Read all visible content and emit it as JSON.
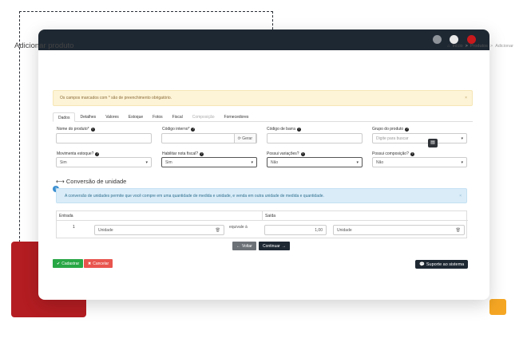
{
  "page": {
    "title": "Adicionar produto"
  },
  "breadcrumb": {
    "home": "Início",
    "sep1": ">",
    "produtos": "Produtos",
    "sep2": ">",
    "current": "Adicionar"
  },
  "alert": {
    "text": "Os campos marcados com * são de preenchimento obrigatório.",
    "close": "×"
  },
  "tabs": [
    "Dados",
    "Detalhes",
    "Valores",
    "Estoque",
    "Fotos",
    "Fiscal",
    "Composição",
    "Fornecedores"
  ],
  "fields": {
    "nome": {
      "label": "Nome do produto*",
      "value": ""
    },
    "codigo_interno": {
      "label": "Código interno*",
      "value": "",
      "action": "Gerar"
    },
    "codigo_barra": {
      "label": "Código de barra",
      "value": ""
    },
    "grupo": {
      "label": "Grupo do produto",
      "placeholder": "Digite para buscar"
    },
    "movimenta": {
      "label": "Movimenta estoque?",
      "value": "Sim"
    },
    "nota_fiscal": {
      "label": "Habilitar nota fiscal?",
      "value": "Sim"
    },
    "variacoes": {
      "label": "Possui variações?",
      "value": "Não"
    },
    "composicao": {
      "label": "Possui composição?",
      "value": "Não"
    }
  },
  "section": {
    "title": "Conversão de unidade"
  },
  "info": {
    "text": "A conversão de unidades permite que você compre em uma quantidade de medida e unidade, e venda em outra unidade de medida e quantidade.",
    "close": "×"
  },
  "conversion": {
    "entrada_label": "Entrada",
    "saida_label": "Saída",
    "entrada_qty": "1",
    "entrada_unit": "Unidade",
    "equivale": "equivale à",
    "saida_qty": "1,00",
    "saida_unit": "Unidade"
  },
  "buttons": {
    "voltar": "Voltar",
    "continuar": "Continuar",
    "cadastrar": "Cadastrar",
    "cancelar": "Cancelar",
    "suporte": "Suporte ao sistema"
  },
  "colors": {
    "dark": "#1e2833",
    "red": "#b41d22",
    "orange": "#f5a623",
    "green": "#28a745",
    "danger": "#e8554e"
  }
}
